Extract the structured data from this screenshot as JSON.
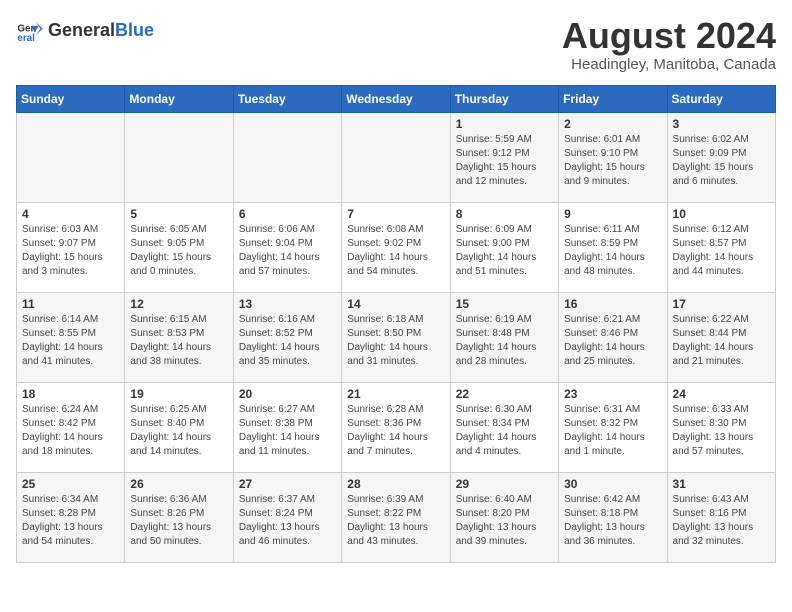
{
  "logo": {
    "general": "General",
    "blue": "Blue"
  },
  "title": {
    "month_year": "August 2024",
    "location": "Headingley, Manitoba, Canada"
  },
  "weekdays": [
    "Sunday",
    "Monday",
    "Tuesday",
    "Wednesday",
    "Thursday",
    "Friday",
    "Saturday"
  ],
  "weeks": [
    [
      {
        "day": "",
        "info": ""
      },
      {
        "day": "",
        "info": ""
      },
      {
        "day": "",
        "info": ""
      },
      {
        "day": "",
        "info": ""
      },
      {
        "day": "1",
        "info": "Sunrise: 5:59 AM\nSunset: 9:12 PM\nDaylight: 15 hours\nand 12 minutes."
      },
      {
        "day": "2",
        "info": "Sunrise: 6:01 AM\nSunset: 9:10 PM\nDaylight: 15 hours\nand 9 minutes."
      },
      {
        "day": "3",
        "info": "Sunrise: 6:02 AM\nSunset: 9:09 PM\nDaylight: 15 hours\nand 6 minutes."
      }
    ],
    [
      {
        "day": "4",
        "info": "Sunrise: 6:03 AM\nSunset: 9:07 PM\nDaylight: 15 hours\nand 3 minutes."
      },
      {
        "day": "5",
        "info": "Sunrise: 6:05 AM\nSunset: 9:05 PM\nDaylight: 15 hours\nand 0 minutes."
      },
      {
        "day": "6",
        "info": "Sunrise: 6:06 AM\nSunset: 9:04 PM\nDaylight: 14 hours\nand 57 minutes."
      },
      {
        "day": "7",
        "info": "Sunrise: 6:08 AM\nSunset: 9:02 PM\nDaylight: 14 hours\nand 54 minutes."
      },
      {
        "day": "8",
        "info": "Sunrise: 6:09 AM\nSunset: 9:00 PM\nDaylight: 14 hours\nand 51 minutes."
      },
      {
        "day": "9",
        "info": "Sunrise: 6:11 AM\nSunset: 8:59 PM\nDaylight: 14 hours\nand 48 minutes."
      },
      {
        "day": "10",
        "info": "Sunrise: 6:12 AM\nSunset: 8:57 PM\nDaylight: 14 hours\nand 44 minutes."
      }
    ],
    [
      {
        "day": "11",
        "info": "Sunrise: 6:14 AM\nSunset: 8:55 PM\nDaylight: 14 hours\nand 41 minutes."
      },
      {
        "day": "12",
        "info": "Sunrise: 6:15 AM\nSunset: 8:53 PM\nDaylight: 14 hours\nand 38 minutes."
      },
      {
        "day": "13",
        "info": "Sunrise: 6:16 AM\nSunset: 8:52 PM\nDaylight: 14 hours\nand 35 minutes."
      },
      {
        "day": "14",
        "info": "Sunrise: 6:18 AM\nSunset: 8:50 PM\nDaylight: 14 hours\nand 31 minutes."
      },
      {
        "day": "15",
        "info": "Sunrise: 6:19 AM\nSunset: 8:48 PM\nDaylight: 14 hours\nand 28 minutes."
      },
      {
        "day": "16",
        "info": "Sunrise: 6:21 AM\nSunset: 8:46 PM\nDaylight: 14 hours\nand 25 minutes."
      },
      {
        "day": "17",
        "info": "Sunrise: 6:22 AM\nSunset: 8:44 PM\nDaylight: 14 hours\nand 21 minutes."
      }
    ],
    [
      {
        "day": "18",
        "info": "Sunrise: 6:24 AM\nSunset: 8:42 PM\nDaylight: 14 hours\nand 18 minutes."
      },
      {
        "day": "19",
        "info": "Sunrise: 6:25 AM\nSunset: 8:40 PM\nDaylight: 14 hours\nand 14 minutes."
      },
      {
        "day": "20",
        "info": "Sunrise: 6:27 AM\nSunset: 8:38 PM\nDaylight: 14 hours\nand 11 minutes."
      },
      {
        "day": "21",
        "info": "Sunrise: 6:28 AM\nSunset: 8:36 PM\nDaylight: 14 hours\nand 7 minutes."
      },
      {
        "day": "22",
        "info": "Sunrise: 6:30 AM\nSunset: 8:34 PM\nDaylight: 14 hours\nand 4 minutes."
      },
      {
        "day": "23",
        "info": "Sunrise: 6:31 AM\nSunset: 8:32 PM\nDaylight: 14 hours\nand 1 minute."
      },
      {
        "day": "24",
        "info": "Sunrise: 6:33 AM\nSunset: 8:30 PM\nDaylight: 13 hours\nand 57 minutes."
      }
    ],
    [
      {
        "day": "25",
        "info": "Sunrise: 6:34 AM\nSunset: 8:28 PM\nDaylight: 13 hours\nand 54 minutes."
      },
      {
        "day": "26",
        "info": "Sunrise: 6:36 AM\nSunset: 8:26 PM\nDaylight: 13 hours\nand 50 minutes."
      },
      {
        "day": "27",
        "info": "Sunrise: 6:37 AM\nSunset: 8:24 PM\nDaylight: 13 hours\nand 46 minutes."
      },
      {
        "day": "28",
        "info": "Sunrise: 6:39 AM\nSunset: 8:22 PM\nDaylight: 13 hours\nand 43 minutes."
      },
      {
        "day": "29",
        "info": "Sunrise: 6:40 AM\nSunset: 8:20 PM\nDaylight: 13 hours\nand 39 minutes."
      },
      {
        "day": "30",
        "info": "Sunrise: 6:42 AM\nSunset: 8:18 PM\nDaylight: 13 hours\nand 36 minutes."
      },
      {
        "day": "31",
        "info": "Sunrise: 6:43 AM\nSunset: 8:16 PM\nDaylight: 13 hours\nand 32 minutes."
      }
    ]
  ]
}
